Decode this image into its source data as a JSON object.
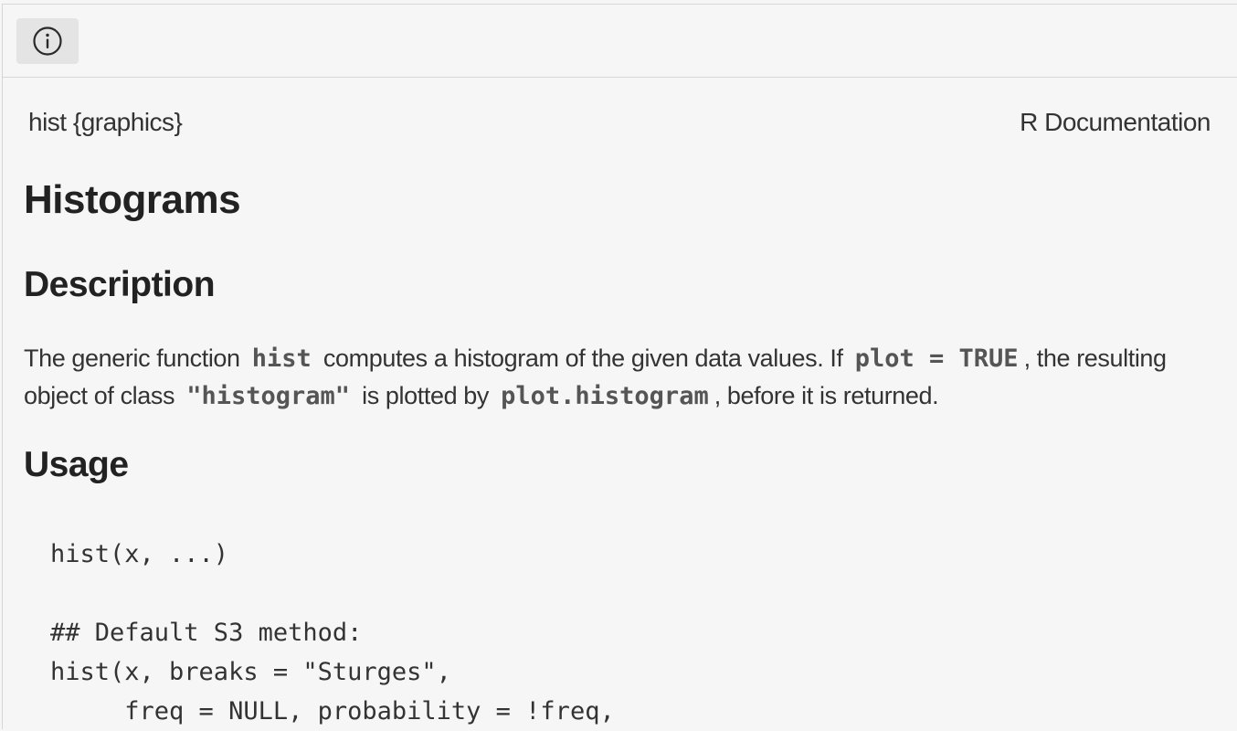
{
  "toolbar": {
    "info_icon": "info-circle-icon"
  },
  "header": {
    "topic": "hist {graphics}",
    "source": "R Documentation"
  },
  "title": "Histograms",
  "description": {
    "heading": "Description",
    "text_1": "The generic function",
    "code_1": "hist",
    "text_2": "computes a histogram of the given data values. If",
    "code_2": "plot = TRUE",
    "text_3": ", the resulting object of class",
    "code_3": "\"histogram\"",
    "text_4": "is plotted by",
    "code_4": "plot.histogram",
    "text_5": ", before it is returned."
  },
  "usage": {
    "heading": "Usage",
    "lines": [
      "hist(x, ...)",
      "",
      "## Default S3 method:",
      "hist(x, breaks = \"Sturges\",",
      "     freq = NULL, probability = !freq,"
    ]
  }
}
